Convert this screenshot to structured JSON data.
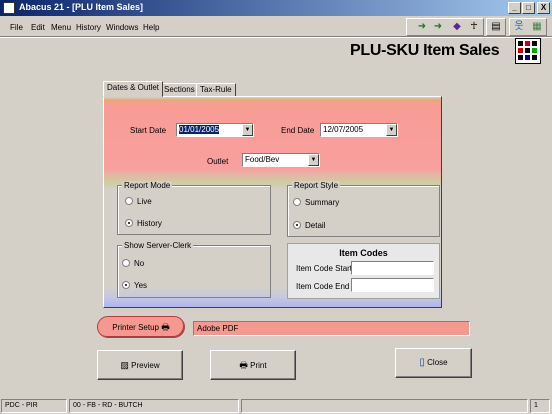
{
  "window": {
    "title": "Abacus 21 - [PLU Item Sales]"
  },
  "window_controls": {
    "minimize": "_",
    "restore": "□",
    "close": "X"
  },
  "menu": [
    "File",
    "Edit",
    "Menu",
    "History",
    "Windows",
    "Help"
  ],
  "page_title": "PLU-SKU Item Sales",
  "tabs": [
    {
      "label": "Dates & Outlet",
      "active": true
    },
    {
      "label": "Sections",
      "active": false
    },
    {
      "label": "Tax-Rule",
      "active": false
    }
  ],
  "filters": {
    "start_date_label": "Start Date",
    "start_date": "01/01/2005",
    "end_date_label": "End Date",
    "end_date": "12/07/2005",
    "outlet_label": "Outlet",
    "outlet": "Food/Bev"
  },
  "report_mode": {
    "title": "Report Mode",
    "options": [
      "Live",
      "History"
    ],
    "selected": "History"
  },
  "report_style": {
    "title": "Report Style",
    "options": [
      "Summary",
      "Detail"
    ],
    "selected": "Detail"
  },
  "show_server_clerk": {
    "title": "Show Server-Clerk",
    "options": [
      "No",
      "Yes"
    ],
    "selected": "Yes"
  },
  "item_codes": {
    "title": "Item Codes",
    "start_label": "Item Code Start",
    "start_value": "",
    "end_label": "Item Code End",
    "end_value": ""
  },
  "printer": {
    "button_label": "Printer Setup",
    "value": "Adobe PDF"
  },
  "actions": {
    "preview": "Preview",
    "print": "Print",
    "close": "Close"
  },
  "status": {
    "pane1": "PDC - PIR",
    "pane2": "00 - FB - RD - BUTCH",
    "pane3": "1"
  },
  "colors": {
    "title_gradient_start": "#0a246a",
    "panel_pink": "#f8a0a0",
    "printer_pink": "#f49890",
    "window_bg": "#d4d0c8"
  }
}
